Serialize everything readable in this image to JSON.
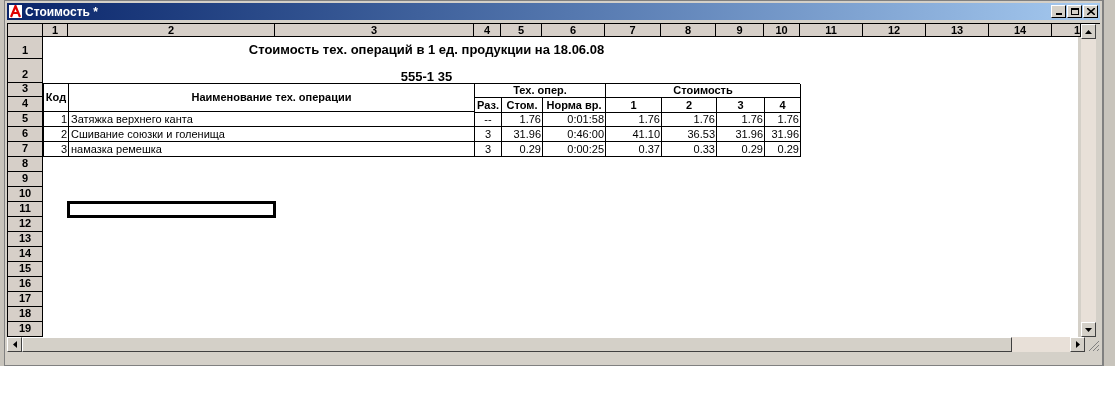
{
  "window": {
    "title": "Стоимость *"
  },
  "column_headers": [
    "1",
    "2",
    "3",
    "4",
    "5",
    "6",
    "7",
    "8",
    "9",
    "10",
    "11",
    "12",
    "13",
    "14",
    "1"
  ],
  "row_headers": [
    "1",
    "2",
    "3",
    "4",
    "5",
    "6",
    "7",
    "8",
    "9",
    "10",
    "11",
    "12",
    "13",
    "14",
    "15",
    "16",
    "17",
    "18",
    "19"
  ],
  "sheet": {
    "title": "Стоимость тех. операций в 1 ед. продукции на 18.06.08",
    "subtitle": "555-1 35",
    "headers": {
      "code": "Код",
      "name": "Наименование тех. операции",
      "group_1": "Тех. опер.",
      "group_1_columns": [
        "Раз.",
        "Стом.",
        "Норма вр."
      ],
      "group_2": "Стоимость",
      "group_2_columns": [
        "1",
        "2",
        "3",
        "4"
      ]
    },
    "rows": [
      {
        "code": "1",
        "name": "Затяжка верхнего канта",
        "grade": "--",
        "cost": "1.76",
        "norm": "0:01:58",
        "costs": [
          "1.76",
          "1.76",
          "1.76",
          "1.76"
        ]
      },
      {
        "code": "2",
        "name": "Сшивание союзки и голенища",
        "grade": "3",
        "cost": "31.96",
        "norm": "0:46:00",
        "costs": [
          "41.10",
          "36.53",
          "31.96",
          "31.96"
        ]
      },
      {
        "code": "3",
        "name": "намазка ремешка",
        "grade": "3",
        "cost": "0.29",
        "norm": "0:00:25",
        "costs": [
          "0.37",
          "0.33",
          "0.29",
          "0.29"
        ]
      }
    ]
  }
}
